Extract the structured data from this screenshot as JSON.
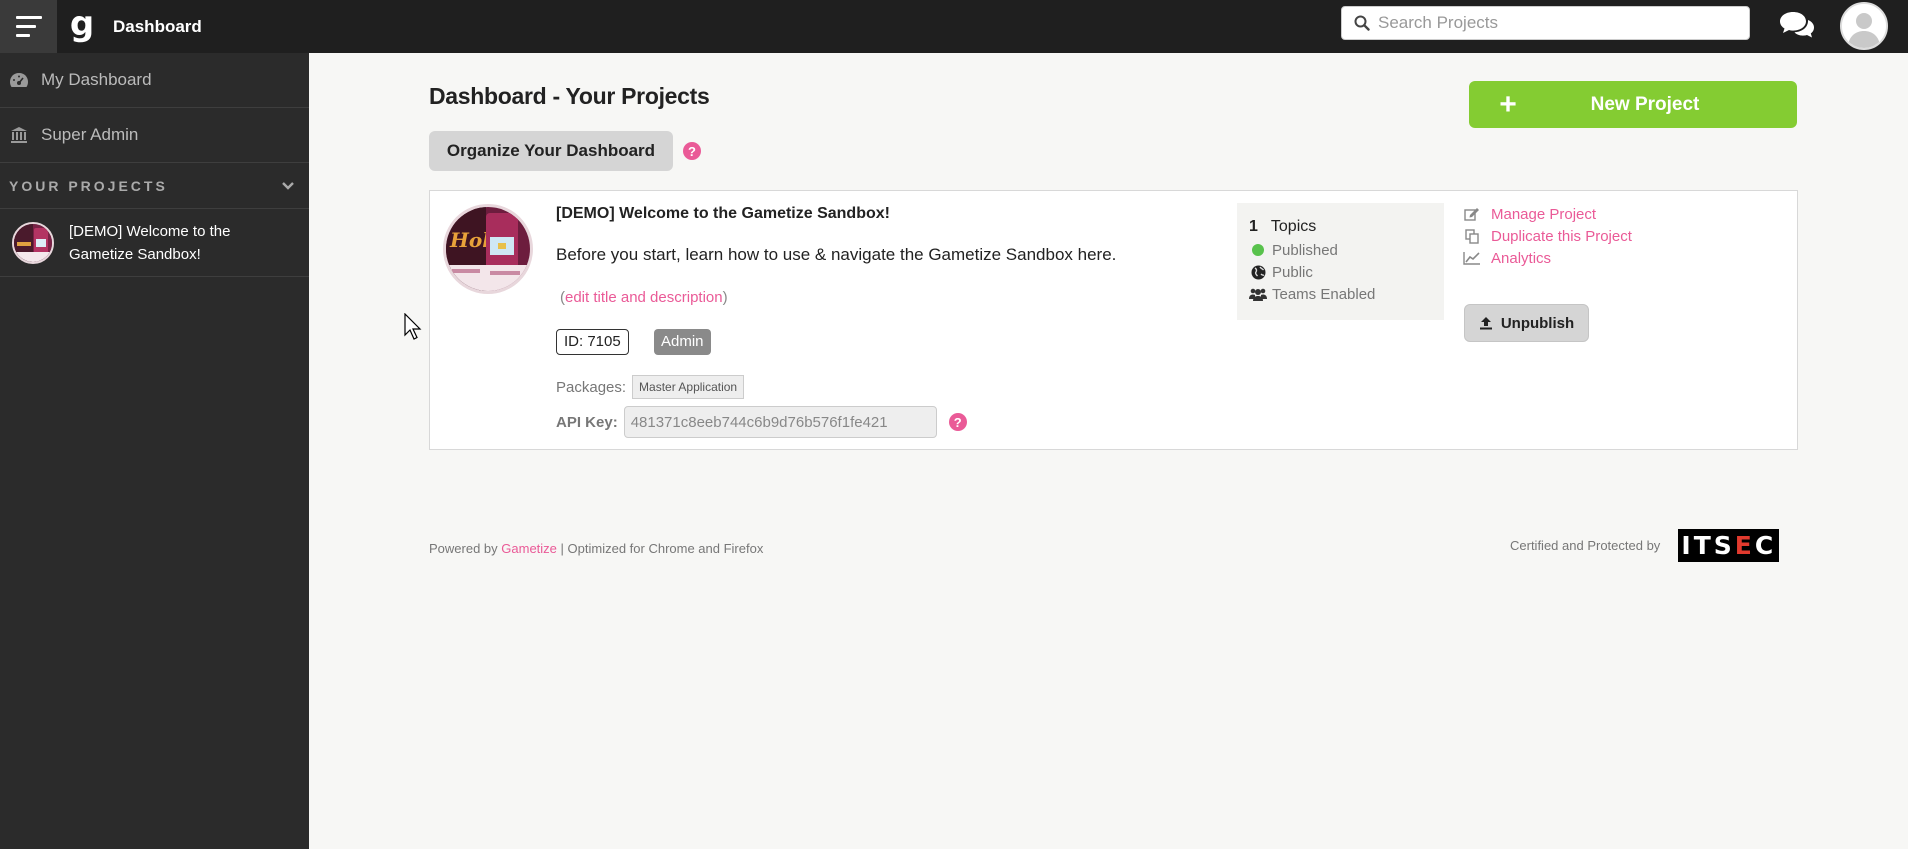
{
  "topbar": {
    "logo": "g",
    "title": "Dashboard",
    "search_placeholder": "Search Projects"
  },
  "sidebar": {
    "items": [
      {
        "label": "My Dashboard",
        "icon": "dashboard-gauge-icon"
      },
      {
        "label": "Super Admin",
        "icon": "bank-icon"
      }
    ],
    "section_label": "YOUR PROJECTS",
    "projects": [
      {
        "label_line1": "[DEMO] Welcome to the",
        "label_line2": "Gametize Sandbox!"
      }
    ]
  },
  "main": {
    "page_title": "Dashboard - Your Projects",
    "organize_label": "Organize Your Dashboard",
    "help_glyph": "?",
    "new_project_label": "New Project",
    "new_project_glyph": "+",
    "card": {
      "title": "[DEMO] Welcome to the Gametize Sandbox!",
      "description": "Before you start, learn how to use & navigate the Gametize Sandbox here.",
      "edit_open": "(",
      "edit_link": "edit title and description",
      "edit_close": ")",
      "id_badge": "ID: 7105",
      "role_badge": "Admin",
      "packages_label": "Packages:",
      "package_tag": "Master Application",
      "api_label": "API Key:",
      "api_value": "481371c8eeb744c6b9d76b576f1fe421",
      "stats": {
        "topics_count": "1",
        "topics_label": "Topics",
        "published": "Published",
        "public": "Public",
        "teams": "Teams Enabled"
      },
      "links": {
        "manage": "Manage Project",
        "duplicate": "Duplicate this Project",
        "analytics": "Analytics"
      },
      "unpublish_label": "Unpublish"
    }
  },
  "footer": {
    "powered_by": "Powered by",
    "brand_link": "Gametize",
    "optimized": "| Optimized for Chrome and Firefox",
    "certified": "Certified and Protected by",
    "badge_pre": "ITS",
    "badge_e": "E",
    "badge_post": "C"
  },
  "colors": {
    "accent_pink": "#ea5a97",
    "primary_green": "#84cc32",
    "topbar_bg": "#1f1f1f",
    "sidebar_bg": "#2b2b2b",
    "status_green": "#58c24c"
  }
}
